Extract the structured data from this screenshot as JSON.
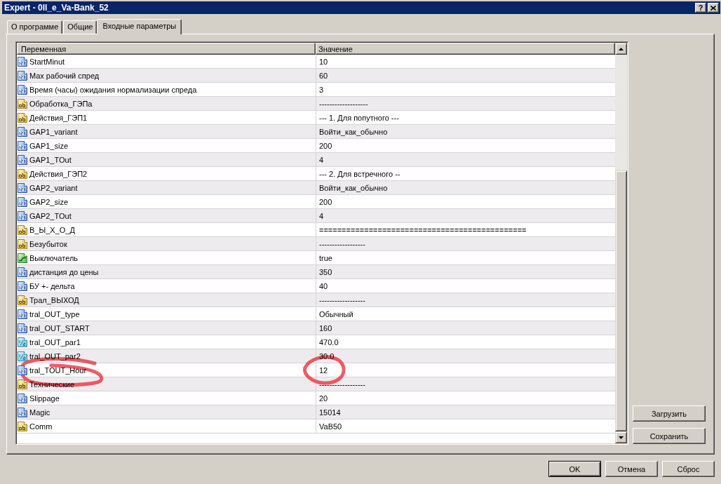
{
  "window": {
    "title": "Expert - 0ll_e_Va-Bank_52",
    "help_button": "?"
  },
  "tabs": [
    {
      "label": "О программе",
      "selected": false
    },
    {
      "label": "Общие",
      "selected": false
    },
    {
      "label": "Входные параметры",
      "selected": true
    }
  ],
  "table": {
    "columns": [
      "Переменная",
      "Значение"
    ],
    "rows": [
      {
        "kind": "int",
        "name": "StartMinut",
        "value": "10",
        "circled": false
      },
      {
        "kind": "int",
        "name": "Max рабочий спред",
        "value": "60",
        "circled": false
      },
      {
        "kind": "int",
        "name": "Время (часы) ожидания нормализации спреда",
        "value": "3",
        "circled": false
      },
      {
        "kind": "string",
        "name": "Обработка_ГЭПа",
        "value": "-------------------",
        "circled": false
      },
      {
        "kind": "string",
        "name": "Действия_ГЭП1",
        "value": "--- 1. Для попутного ---",
        "circled": false
      },
      {
        "kind": "int",
        "name": "GAP1_variant",
        "value": "Войти_как_обычно",
        "circled": false
      },
      {
        "kind": "int",
        "name": "GAP1_size",
        "value": "200",
        "circled": false
      },
      {
        "kind": "int",
        "name": "GAP1_TOut",
        "value": "4",
        "circled": false
      },
      {
        "kind": "string",
        "name": "Действия_ГЭП2",
        "value": "--- 2. Для встречного --",
        "circled": false
      },
      {
        "kind": "int",
        "name": "GAP2_variant",
        "value": "Войти_как_обычно",
        "circled": false
      },
      {
        "kind": "int",
        "name": "GAP2_size",
        "value": "200",
        "circled": false
      },
      {
        "kind": "int",
        "name": "GAP2_TOut",
        "value": "4",
        "circled": false
      },
      {
        "kind": "string",
        "name": "В_Ы_Х_О_Д",
        "value": "==============================================",
        "circled": false
      },
      {
        "kind": "string",
        "name": "Безубыток",
        "value": "------------------",
        "circled": false
      },
      {
        "kind": "bool",
        "name": "Выключатель",
        "value": "true",
        "circled": false
      },
      {
        "kind": "int",
        "name": "дистанция до цены",
        "value": "350",
        "circled": false
      },
      {
        "kind": "int",
        "name": "БУ +- дельта",
        "value": "40",
        "circled": false
      },
      {
        "kind": "string",
        "name": "Трал_ВЫХОД",
        "value": "------------------",
        "circled": false
      },
      {
        "kind": "int",
        "name": "tral_OUT_type",
        "value": "Обычный",
        "circled": false
      },
      {
        "kind": "int",
        "name": "tral_OUT_START",
        "value": "160",
        "circled": false
      },
      {
        "kind": "double",
        "name": "tral_OUT_par1",
        "value": "470.0",
        "circled": false
      },
      {
        "kind": "double",
        "name": "tral_OUT_par2",
        "value": "30.0",
        "circled": false
      },
      {
        "kind": "int",
        "name": "tral_TOUT_Hour",
        "value": "12",
        "circled": true
      },
      {
        "kind": "string",
        "name": "Технические",
        "value": "------------------",
        "circled": false
      },
      {
        "kind": "int",
        "name": "Slippage",
        "value": "20",
        "circled": false
      },
      {
        "kind": "int",
        "name": "Magic",
        "value": "15014",
        "circled": false
      },
      {
        "kind": "string",
        "name": "Comm",
        "value": "VaB50",
        "circled": false
      }
    ]
  },
  "side_buttons": [
    "Загрузить",
    "Сохранить"
  ],
  "buttons": [
    {
      "label": "OK",
      "default": true
    },
    {
      "label": "Отмена",
      "default": false
    },
    {
      "label": "Сброс",
      "default": false
    }
  ]
}
